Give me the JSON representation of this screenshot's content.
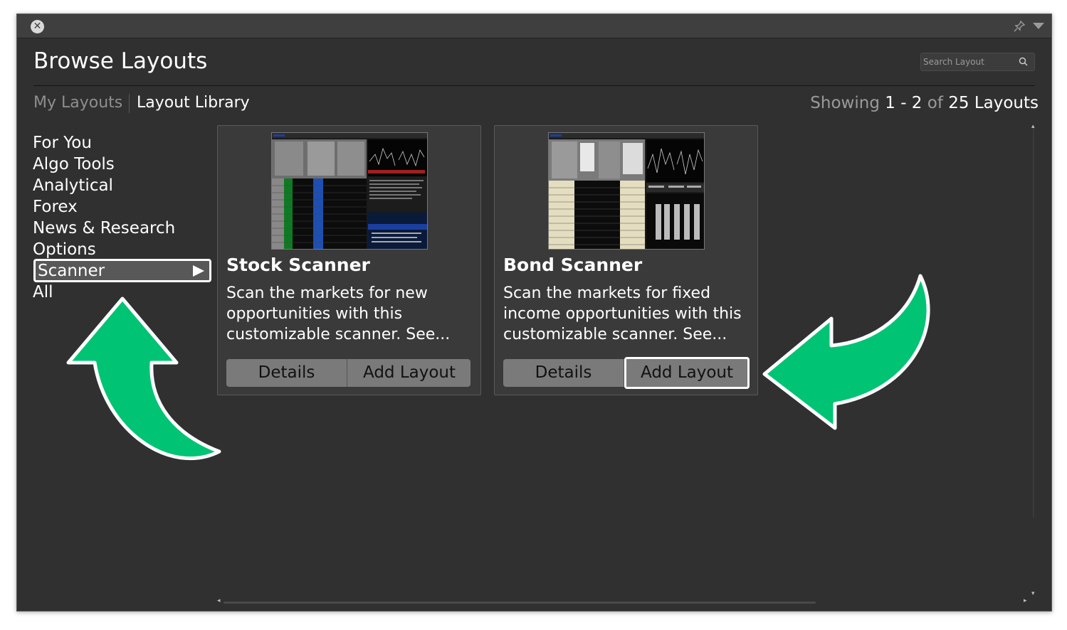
{
  "window": {
    "close_label": "✕",
    "title": "Browse Layouts",
    "search": {
      "placeholder": "Search Layout"
    }
  },
  "tabs": [
    {
      "label": "My Layouts",
      "active": false
    },
    {
      "label": "Layout Library",
      "active": true
    }
  ],
  "showing": {
    "prefix": "Showing",
    "range": "1 - 2",
    "of": "of",
    "total": "25 Layouts"
  },
  "categories": [
    "For You",
    "Algo Tools",
    "Analytical",
    "Forex",
    "News & Research",
    "Options",
    "Scanner",
    "All"
  ],
  "selected_category": "Scanner",
  "layouts": [
    {
      "title": "Stock Scanner",
      "description": "Scan the markets for new opportunities with this customizable scanner. See...",
      "details_label": "Details",
      "add_label": "Add Layout"
    },
    {
      "title": "Bond Scanner",
      "description": "Scan the markets for fixed income opportunities with this customizable scanner. See...",
      "details_label": "Details",
      "add_label": "Add Layout"
    }
  ],
  "colors": {
    "annotation_arrow": "#00c473",
    "window_bg": "#303030"
  },
  "icons": [
    "close-icon",
    "pin-icon",
    "dropdown-menu-icon",
    "search-icon",
    "chevron-right-icon"
  ]
}
